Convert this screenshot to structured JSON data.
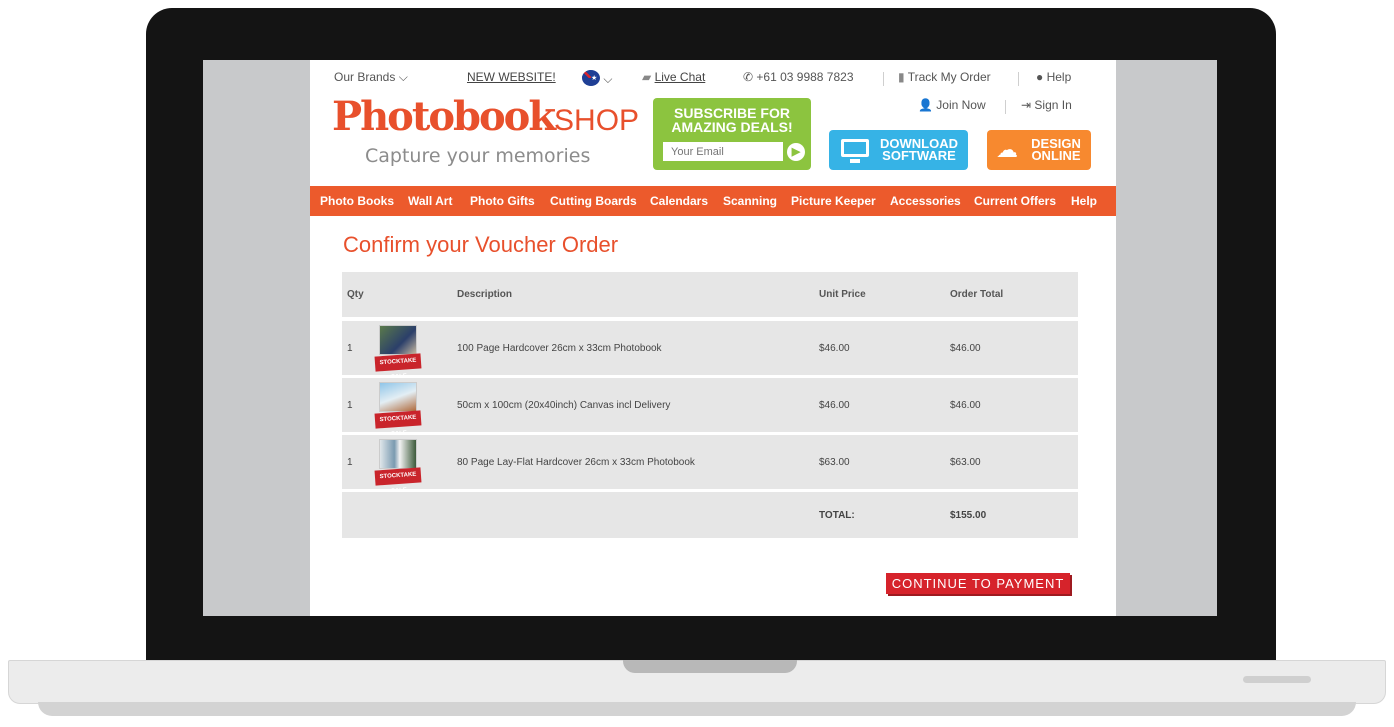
{
  "topbar": {
    "brands": "Our Brands",
    "new_website": "NEW WEBSITE!",
    "live_chat": "Live Chat",
    "phone": "+61 03 9988 7823",
    "track": "Track My Order",
    "help": "Help",
    "join": "Join Now",
    "signin": "Sign In"
  },
  "logo": {
    "main": "Photobook",
    "suffix": "SHOP",
    "tagline": "Capture your memories"
  },
  "subscribe": {
    "line1": "SUBSCRIBE FOR",
    "line2": "AMAZING DEALS!",
    "placeholder": "Your Email"
  },
  "cta": {
    "download_1": "DOWNLOAD",
    "download_2": "SOFTWARE",
    "design_1": "DESIGN",
    "design_2": "ONLINE"
  },
  "nav": [
    "Photo Books",
    "Wall Art",
    "Photo Gifts",
    "Cutting Boards",
    "Calendars",
    "Scanning",
    "Picture Keeper",
    "Accessories",
    "Current Offers",
    "Help"
  ],
  "page_title": "Confirm your Voucher Order",
  "table": {
    "headers": {
      "qty": "Qty",
      "description": "Description",
      "unit_price": "Unit Price",
      "order_total": "Order Total"
    },
    "rows": [
      {
        "qty": "1",
        "description": "100 Page Hardcover 26cm x 33cm Photobook",
        "unit_price": "$46.00",
        "order_total": "$46.00",
        "badge": "STOCKTAKE SALE"
      },
      {
        "qty": "1",
        "description": "50cm x 100cm (20x40inch) Canvas incl Delivery",
        "unit_price": "$46.00",
        "order_total": "$46.00",
        "badge": "STOCKTAKE SALE"
      },
      {
        "qty": "1",
        "description": "80 Page Lay-Flat Hardcover 26cm x 33cm Photobook",
        "unit_price": "$63.00",
        "order_total": "$63.00",
        "badge": "STOCKTAKE SALE"
      }
    ],
    "total_label": "TOTAL:",
    "total_value": "$155.00"
  },
  "continue_button": "CONTINUE TO PAYMENT",
  "colors": {
    "brand": "#e8502c",
    "nav": "#ec5a2c",
    "subscribe": "#8cc43f",
    "download": "#36b3e6",
    "design": "#f7892f",
    "pay": "#d6232b"
  }
}
